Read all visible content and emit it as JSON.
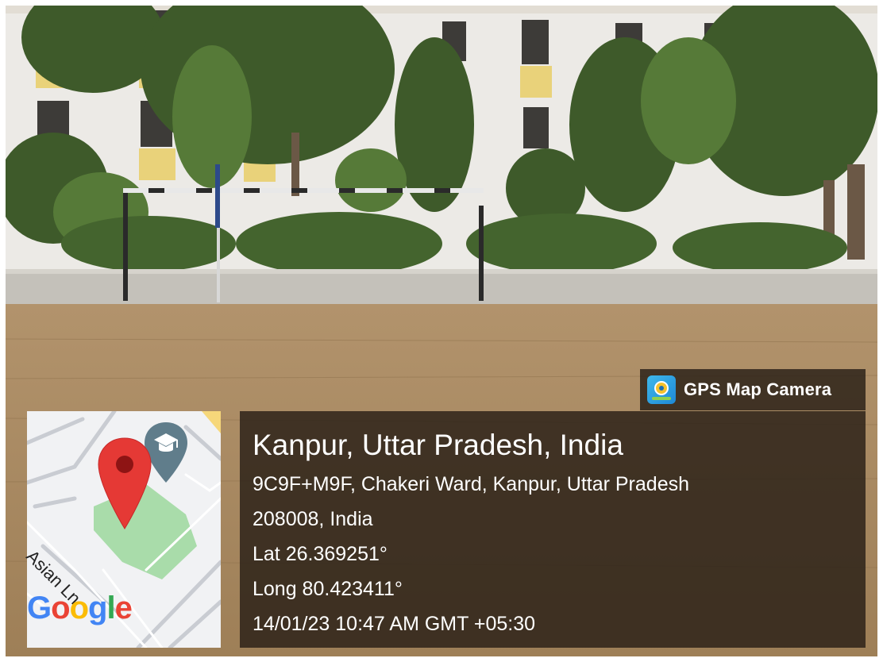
{
  "badge": {
    "icon": "gps-map-camera-icon",
    "label": "GPS Map Camera"
  },
  "location": {
    "title": "Kanpur, Uttar Pradesh, India",
    "address_line1": "9C9F+M9F, Chakeri Ward, Kanpur, Uttar Pradesh",
    "address_line2": "208008, India",
    "latitude": "Lat 26.369251°",
    "longitude": "Long 80.423411°",
    "timestamp": "14/01/23 10:47 AM GMT +05:30"
  },
  "map": {
    "street_label": "Asian Ln",
    "logo": {
      "letters": [
        "G",
        "o",
        "o",
        "g",
        "l",
        "e"
      ],
      "colors": [
        "#4285F4",
        "#EA4335",
        "#FBBC05",
        "#4285F4",
        "#34A853",
        "#EA4335"
      ]
    },
    "marker_icon": "location-pin-icon",
    "poi_icon": "school-icon",
    "colors": {
      "park": "#a9dcaa",
      "pin": "#e53935",
      "poi": "#607d8b"
    }
  }
}
